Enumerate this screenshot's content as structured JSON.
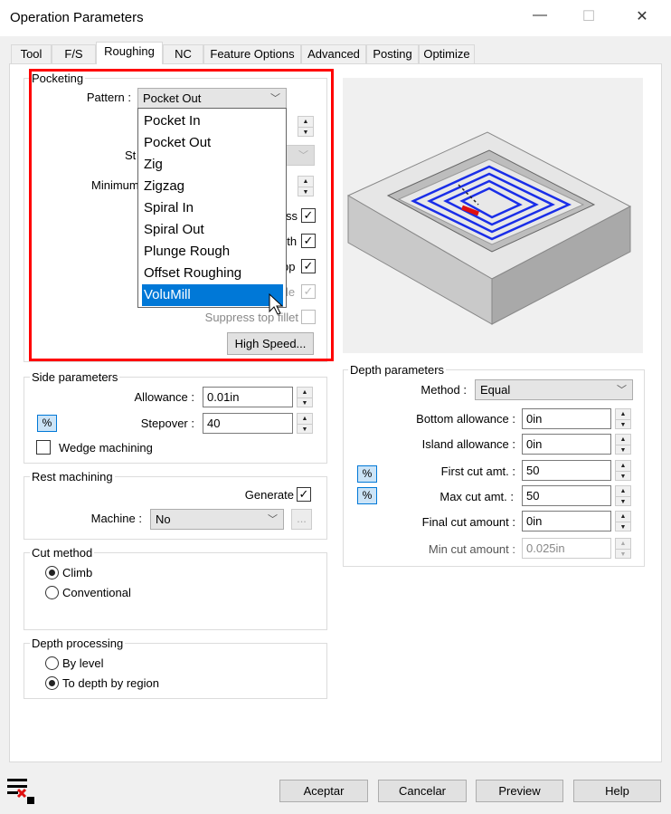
{
  "window": {
    "title": "Operation Parameters",
    "minimize": "—",
    "maximize": "☐",
    "close": "✕"
  },
  "tabs": [
    {
      "label": "Tool"
    },
    {
      "label": "F/S"
    },
    {
      "label": "Roughing",
      "selected": true
    },
    {
      "label": "NC"
    },
    {
      "label": "Feature Options"
    },
    {
      "label": "Advanced"
    },
    {
      "label": "Posting"
    },
    {
      "label": "Optimize"
    }
  ],
  "highlight_color": "#ff0000",
  "pocketing": {
    "title": "Pocketing",
    "pattern_label": "Pattern :",
    "pattern_value": "Pocket Out",
    "pattern_options": [
      "Pocket In",
      "Pocket Out",
      "Zig",
      "Zigzag",
      "Spiral In",
      "Spiral Out",
      "Plunge Rough",
      "Offset Roughing",
      "VoluMill"
    ],
    "highlighted_option": "VoluMill",
    "partial_labels": {
      "start": "St",
      "minimum": "Minimum",
      "c1": "ss",
      "c2": "pth",
      "c3": "pp",
      "c4": "le"
    },
    "checks": [
      true,
      true,
      true,
      true
    ],
    "suppress_label": "Suppress top fillet",
    "suppress_checked": false,
    "high_speed_label": "High Speed..."
  },
  "side": {
    "title": "Side parameters",
    "allowance_label": "Allowance :",
    "allowance_value": "0.01in",
    "pct": "%",
    "stepover_label": "Stepover :",
    "stepover_value": "40",
    "wedge_label": "Wedge machining",
    "wedge_checked": false
  },
  "rest": {
    "title": "Rest machining",
    "generate_label": "Generate",
    "generate_checked": true,
    "machine_label": "Machine :",
    "machine_value": "No",
    "ellipsis": "..."
  },
  "cut": {
    "title": "Cut method",
    "options": [
      "Climb",
      "Conventional"
    ],
    "selected": "Climb"
  },
  "depthproc": {
    "title": "Depth processing",
    "options": [
      "By level",
      "To depth by region"
    ],
    "selected": "To depth by region"
  },
  "depth": {
    "title": "Depth parameters",
    "method_label": "Method :",
    "method_value": "Equal",
    "rows": [
      {
        "label": "Bottom allowance :",
        "value": "0in"
      },
      {
        "label": "Island allowance :",
        "value": "0in"
      },
      {
        "label": "First cut amt. :",
        "value": "50",
        "pct": "%"
      },
      {
        "label": "Max cut amt. :",
        "value": "50",
        "pct": "%"
      },
      {
        "label": "Final cut amount :",
        "value": "0in"
      },
      {
        "label": "Min cut amount :",
        "value": "0.025in",
        "disabled": true
      }
    ]
  },
  "footer": {
    "ok": "Aceptar",
    "cancel": "Cancelar",
    "preview": "Preview",
    "help": "Help"
  },
  "icons": {
    "spin_up": "▲",
    "spin_down": "▼",
    "chevron": "﹀",
    "check": "✓"
  }
}
